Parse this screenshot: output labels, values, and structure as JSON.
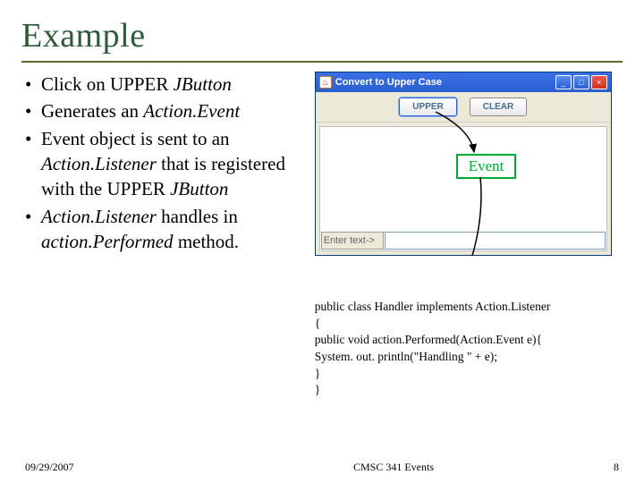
{
  "title": "Example",
  "bullets": [
    {
      "pre": "Click on UPPER ",
      "it": "JButton",
      "post": ""
    },
    {
      "pre": "Generates an ",
      "it": "Action.Event",
      "post": ""
    },
    {
      "pre": "Event object is sent to an ",
      "it": "Action.Listener",
      "post": " that is registered with the UPPER ",
      "it2": "JButton"
    },
    {
      "it0": "Action.Listener",
      "post0": " handles in ",
      "it": "action.Performed",
      "post": " method."
    }
  ],
  "window": {
    "title": "Convert to Upper Case",
    "min": "_",
    "max": "□",
    "close": "×",
    "buttons": {
      "upper": "UPPER",
      "clear": "CLEAR"
    },
    "enter_label": "Enter text->"
  },
  "event_label": "Event",
  "code": {
    "l1": "public class Handler implements Action.Listener",
    "l2": "{",
    "l3": "  public void action.Performed(Action.Event e){",
    "l4": "     System. out. println(\"Handling \" + e);",
    "l5": "  }",
    "l6": "}"
  },
  "footer": {
    "date": "09/29/2007",
    "center": "CMSC 341 Events",
    "page": "8"
  }
}
